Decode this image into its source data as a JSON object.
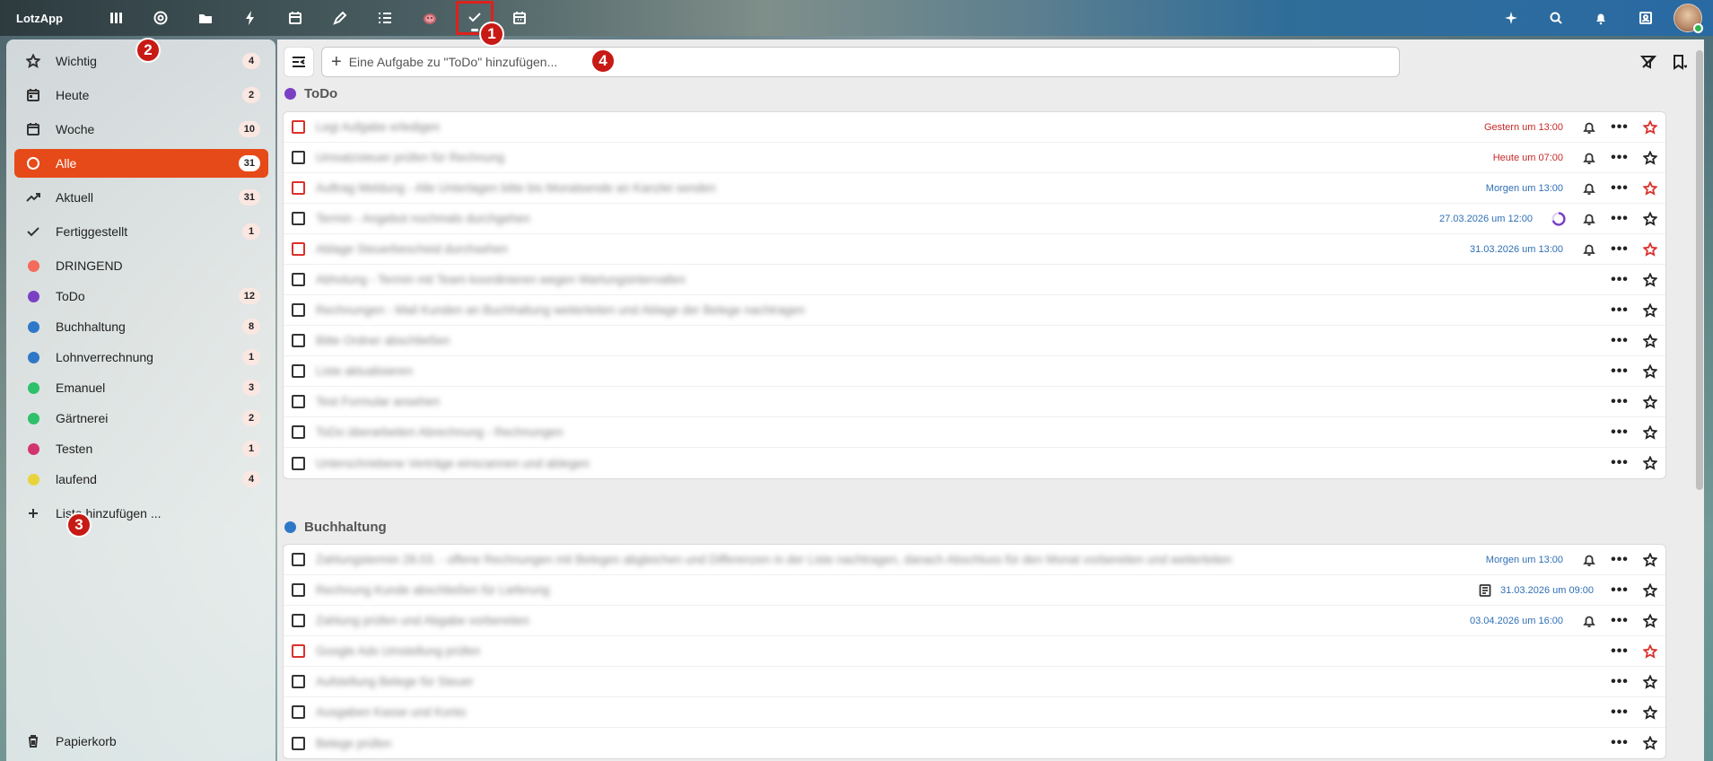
{
  "app": {
    "logo": "LotzApp",
    "top_icons_left": [
      "columns-icon",
      "helpdesk-icon",
      "folder-icon",
      "bolt-icon",
      "calendar-icon",
      "pen-icon",
      "list-icon",
      "pig-icon",
      "todo-icon",
      "calendar-grid-icon"
    ],
    "top_icons_right": [
      "sparkle-icon",
      "search-icon",
      "bell-icon",
      "contacts-icon"
    ]
  },
  "markers": [
    "1",
    "2",
    "3",
    "4"
  ],
  "sidebar": {
    "smart_lists": [
      {
        "label": "Wichtig",
        "count": "4",
        "icon": "star-icon"
      },
      {
        "label": "Heute",
        "count": "2",
        "icon": "calendar-today-icon"
      },
      {
        "label": "Woche",
        "count": "10",
        "icon": "calendar-week-icon"
      },
      {
        "label": "Alle",
        "count": "31",
        "icon": "circle-icon",
        "active": true
      },
      {
        "label": "Aktuell",
        "count": "31",
        "icon": "trending-icon"
      },
      {
        "label": "Fertiggestellt",
        "count": "1",
        "icon": "check-icon"
      }
    ],
    "lists": [
      {
        "label": "DRINGEND",
        "count": "",
        "color": "#f26b5b"
      },
      {
        "label": "ToDo",
        "count": "12",
        "color": "#7b3fc4"
      },
      {
        "label": "Buchhaltung",
        "count": "8",
        "color": "#2f78c8"
      },
      {
        "label": "Lohnverrechnung",
        "count": "1",
        "color": "#2f78c8"
      },
      {
        "label": "Emanuel",
        "count": "3",
        "color": "#2ec06a"
      },
      {
        "label": "Gärtnerei",
        "count": "2",
        "color": "#2ec06a"
      },
      {
        "label": "Testen",
        "count": "1",
        "color": "#d2346f"
      },
      {
        "label": "laufend",
        "count": "4",
        "color": "#e8d43a"
      }
    ],
    "add_list_label": "Liste hinzufügen ...",
    "trash_label": "Papierkorb"
  },
  "main": {
    "add_task_placeholder": "Eine Aufgabe zu \"ToDo\" hinzufügen...",
    "sections": [
      {
        "name": "ToDo",
        "color": "#7b3fc4",
        "tasks": [
          {
            "title": "Legi Aufgabe erledigen",
            "due": "Gestern um 13:00",
            "due_color": "red",
            "checkbox_red": true,
            "bell": true,
            "star_red": true
          },
          {
            "title": "Umsatzsteuer prüfen für Rechnung",
            "due": "Heute um 07:00",
            "due_color": "red",
            "checkbox_red": false,
            "bell": true,
            "star_red": false
          },
          {
            "title": "Auftrag Meldung - Alle Unterlagen bitte bis Monatsende an Kanzlei senden",
            "due": "Morgen um 13:00",
            "due_color": "blue",
            "checkbox_red": true,
            "bell": true,
            "star_red": true
          },
          {
            "title": "Termin - Angebot nochmals durchgehen",
            "due": "27.03.2026 um 12:00",
            "due_color": "blue",
            "checkbox_red": false,
            "bell": true,
            "star_red": false,
            "progress": 0.7
          },
          {
            "title": "Ablage Steuerbescheid durchsehen",
            "due": "31.03.2026 um 13:00",
            "due_color": "blue",
            "checkbox_red": true,
            "bell": true,
            "star_red": true
          },
          {
            "title": "Abholung - Termin mit Team koordinieren wegen Wartungsintervallen",
            "due": "",
            "checkbox_red": false,
            "bell": false,
            "star_red": false
          },
          {
            "title": "Rechnungen - Mail Kunden an Buchhaltung weiterleiten und Ablage der Belege nachtragen",
            "due": "",
            "checkbox_red": false,
            "bell": false,
            "star_red": false
          },
          {
            "title": "Bitte Ordner abschließen",
            "due": "",
            "checkbox_red": false,
            "bell": false,
            "star_red": false
          },
          {
            "title": "Liste aktualisieren",
            "due": "",
            "checkbox_red": false,
            "bell": false,
            "star_red": false
          },
          {
            "title": "Test Formular ansehen",
            "due": "",
            "checkbox_red": false,
            "bell": false,
            "star_red": false
          },
          {
            "title": "ToDo überarbeiten Abrechnung - Rechnungen",
            "due": "",
            "checkbox_red": false,
            "bell": false,
            "star_red": false
          },
          {
            "title": "Unterschriebene Verträge einscannen und ablegen",
            "due": "",
            "checkbox_red": false,
            "bell": false,
            "star_red": false
          }
        ]
      },
      {
        "name": "Buchhaltung",
        "color": "#2f78c8",
        "tasks": [
          {
            "title": "Zahlungstermin 28.03. - offene Rechnungen mit Belegen abgleichen und Differenzen in der Liste nachtragen, danach Abschluss für den Monat vorbereiten und weiterleiten",
            "due": "Morgen um 13:00",
            "due_color": "blue",
            "checkbox_red": false,
            "bell": true,
            "star_red": false
          },
          {
            "title": "Rechnung Kunde abschließen für Lieferung",
            "due": "31.03.2026 um 09:00",
            "due_color": "blue",
            "checkbox_red": false,
            "bell": false,
            "note": true,
            "star_red": false
          },
          {
            "title": "Zahlung prüfen und Abgabe vorbereiten",
            "due": "03.04.2026 um 16:00",
            "due_color": "blue",
            "checkbox_red": false,
            "bell": true,
            "star_red": false
          },
          {
            "title": "Google Ads Umstellung prüfen",
            "due": "",
            "checkbox_red": true,
            "bell": false,
            "star_red": true
          },
          {
            "title": "Aufstellung Belege für Steuer",
            "due": "",
            "checkbox_red": false,
            "bell": false,
            "star_red": false
          },
          {
            "title": "Ausgaben Kasse und Konto",
            "due": "",
            "checkbox_red": false,
            "bell": false,
            "star_red": false
          },
          {
            "title": "Belege prüfen",
            "due": "",
            "checkbox_red": false,
            "bell": false,
            "star_red": false
          }
        ]
      }
    ]
  }
}
